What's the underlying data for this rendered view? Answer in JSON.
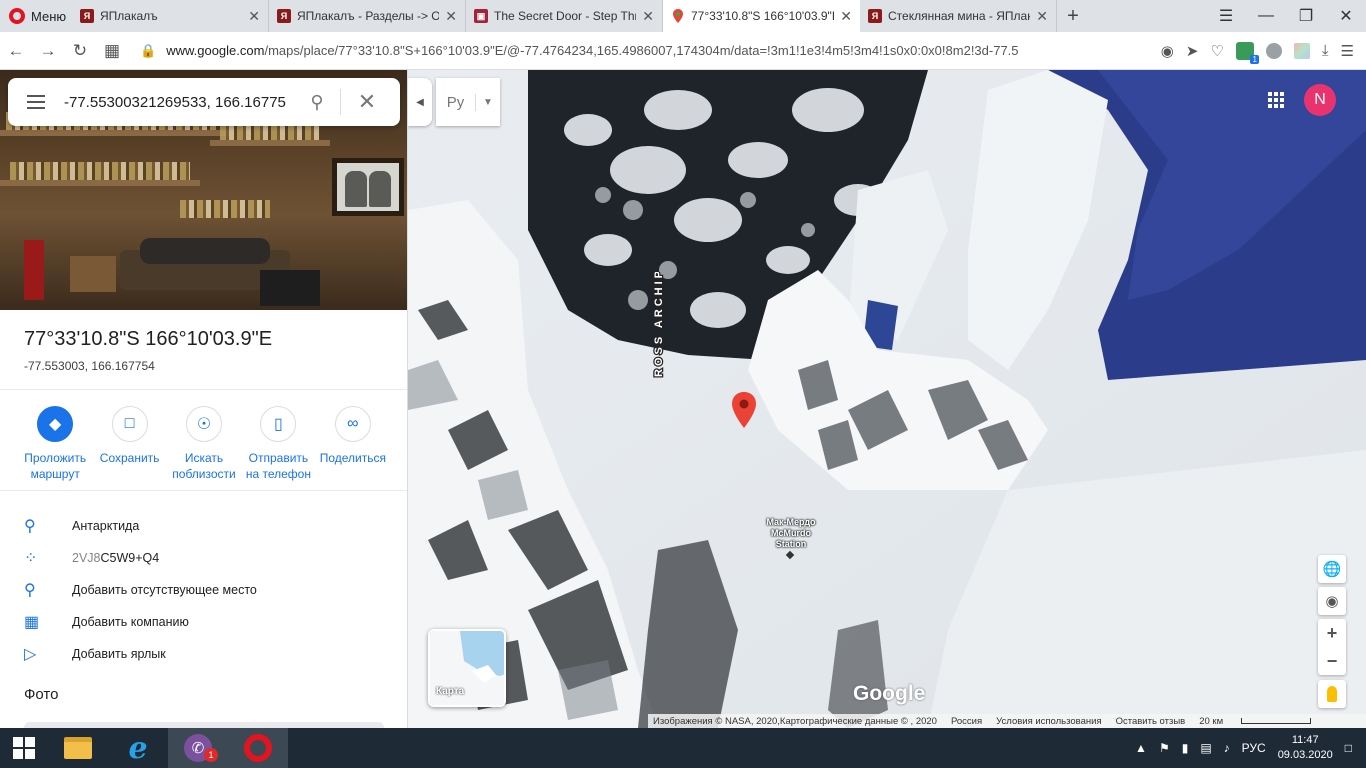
{
  "browser": {
    "menu_label": "Меню",
    "tabs": [
      {
        "title": "ЯПлакалъ",
        "icon": "yaplakal-favicon"
      },
      {
        "title": "ЯПлакалъ - Разделы -> От",
        "icon": "yaplakal-favicon"
      },
      {
        "title": "The Secret Door - Step Thr",
        "icon": "secret-door-favicon"
      },
      {
        "title": "77°33'10.8\"S 166°10'03.9\"E",
        "icon": "google-maps-favicon"
      },
      {
        "title": "Стеклянная мина - ЯПлака",
        "icon": "yaplakal-favicon"
      }
    ],
    "active_tab": 3,
    "url_host": "www.google.com",
    "url_rest": "/maps/place/77°33'10.8\"S+166°10'03.9\"E/@-77.4764234,165.4986007,174304m/data=!3m1!1e3!4m5!3m4!1s0x0:0x0!8m2!3d-77.5"
  },
  "search": {
    "value": "-77.55300321269533, 166.16775"
  },
  "map_controls": {
    "language_value": "Ру",
    "avatar_letter": "N",
    "minimap_label": "Карта",
    "google_logo": "Google"
  },
  "place": {
    "title": "77°33'10.8\"S 166°10'03.9\"E",
    "decimal": "-77.553003, 166.167754",
    "actions": [
      {
        "label": "Проложить маршрут"
      },
      {
        "label": "Сохранить"
      },
      {
        "label": "Искать поблизости"
      },
      {
        "label": "Отправить на телефон"
      },
      {
        "label": "Поделиться"
      }
    ],
    "info": {
      "region": "Антарктида",
      "plus_code_prefix": "2VJ8",
      "plus_code_rest": "C5W9+Q4",
      "add_missing": "Добавить отсутствующее место",
      "add_business": "Добавить компанию",
      "add_label": "Добавить ярлык"
    },
    "photos_heading": "Фото"
  },
  "map_labels": {
    "archipelago": "ROSS ARCHIPELAGO",
    "station_ru": "Мак-Мердо",
    "station_en": "McMurdo",
    "station_word": "Station"
  },
  "attribution": {
    "imagery": "Изображения © NASA, 2020,Картографические данные © , 2020",
    "country": "Россия",
    "terms": "Условия использования",
    "feedback": "Оставить отзыв",
    "scale": "20 км"
  },
  "taskbar": {
    "lang": "РУС",
    "time": "11:47",
    "date": "09.03.2020",
    "viber_badge": "1"
  },
  "colors": {
    "maps_blue": "#1a73e8",
    "pin_red": "#ea4335",
    "avatar_pink": "#e8336e",
    "opera_red": "#e2141f"
  }
}
